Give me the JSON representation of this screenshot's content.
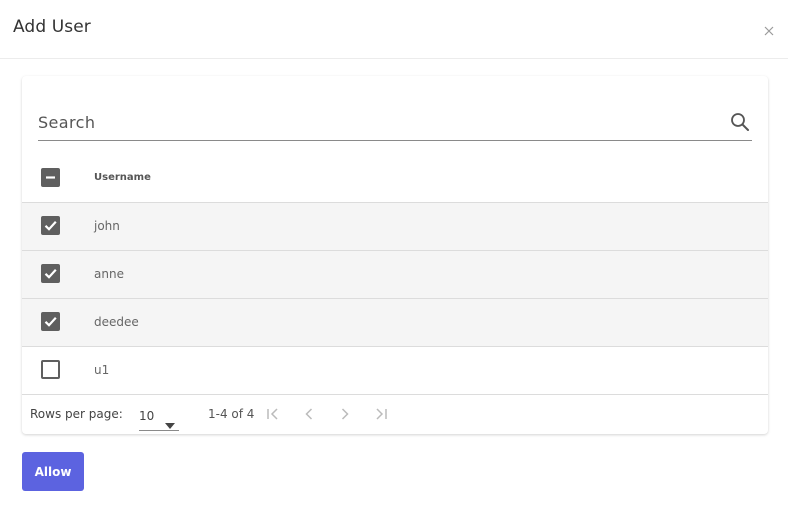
{
  "dialog": {
    "title": "Add User",
    "close_icon": "close-icon"
  },
  "search": {
    "placeholder": "Search",
    "value": "",
    "icon": "search-icon"
  },
  "table": {
    "header": {
      "select_all_state": "indeterminate",
      "columns": [
        "Username"
      ]
    },
    "rows": [
      {
        "username": "john",
        "checked": true
      },
      {
        "username": "anne",
        "checked": true
      },
      {
        "username": "deedee",
        "checked": true
      },
      {
        "username": "u1",
        "checked": false
      }
    ]
  },
  "pagination": {
    "rows_per_page_label": "Rows per page:",
    "rows_per_page_value": "10",
    "range": "1-4 of 4"
  },
  "actions": {
    "allow_label": "Allow"
  },
  "colors": {
    "accent": "#5c63e0",
    "checkbox": "#5f5f5f",
    "selected_row": "#f5f5f5"
  }
}
